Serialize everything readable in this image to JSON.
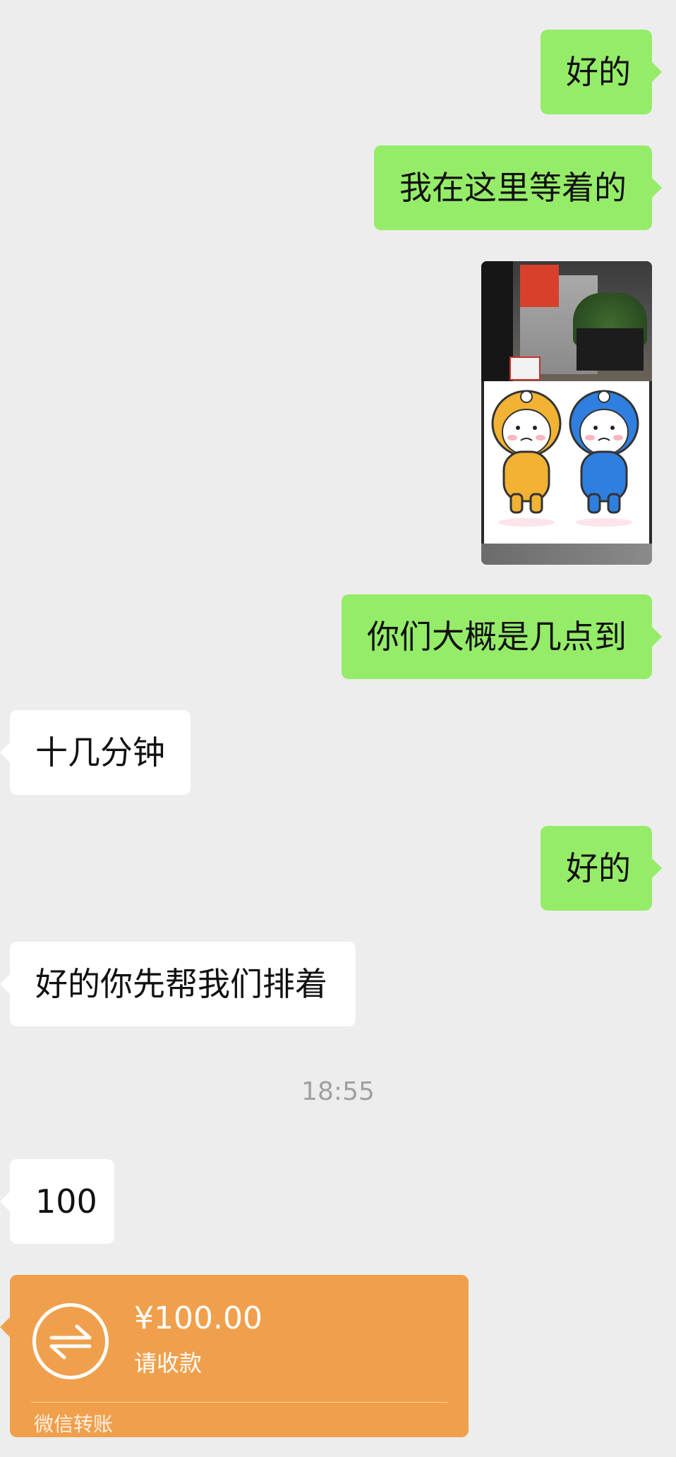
{
  "messages": [
    {
      "id": "m1",
      "side": "out",
      "text": "好的"
    },
    {
      "id": "m2",
      "side": "out",
      "text": "我在这里等着的"
    },
    {
      "id": "m3",
      "side": "out",
      "type": "image",
      "icon": "meme-image"
    },
    {
      "id": "m4",
      "side": "out",
      "text": "你们大概是几点到"
    },
    {
      "id": "m5",
      "side": "in",
      "text": "十几分钟"
    },
    {
      "id": "m6",
      "side": "out",
      "text": "好的"
    },
    {
      "id": "m7",
      "side": "in",
      "text": "好的你先帮我们排着"
    },
    {
      "id": "m8",
      "side": "in",
      "text": "100"
    }
  ],
  "timestamp": "18:55",
  "transfer": {
    "amount": "¥100.00",
    "note": "请收款",
    "footer": "微信转账",
    "color": "#f0a04c",
    "icon": "transfer-arrows-icon"
  },
  "colors": {
    "background": "#ededed",
    "outgoing_bubble": "#95ec69",
    "incoming_bubble": "#ffffff"
  }
}
